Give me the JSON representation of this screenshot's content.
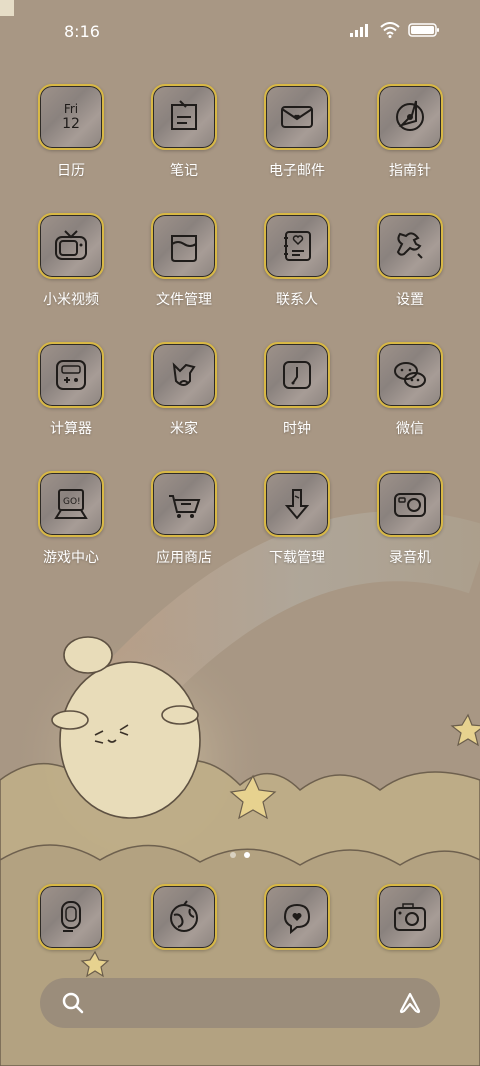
{
  "status": {
    "time": "8:16",
    "signal_icon": "signal-bars-icon",
    "wifi_icon": "wifi-icon",
    "battery_icon": "battery-icon"
  },
  "apps": [
    {
      "label": "日历",
      "icon": "calendar-icon",
      "day": "Fri",
      "date": "12"
    },
    {
      "label": "笔记",
      "icon": "notes-icon"
    },
    {
      "label": "电子邮件",
      "icon": "mail-icon"
    },
    {
      "label": "指南针",
      "icon": "compass-icon"
    },
    {
      "label": "小米视频",
      "icon": "tv-icon"
    },
    {
      "label": "文件管理",
      "icon": "folder-jar-icon"
    },
    {
      "label": "联系人",
      "icon": "contacts-book-icon"
    },
    {
      "label": "设置",
      "icon": "wrench-icon"
    },
    {
      "label": "计算器",
      "icon": "calculator-icon"
    },
    {
      "label": "米家",
      "icon": "mijia-icon"
    },
    {
      "label": "时钟",
      "icon": "clock-icon"
    },
    {
      "label": "微信",
      "icon": "wechat-icon"
    },
    {
      "label": "游戏中心",
      "icon": "game-console-icon"
    },
    {
      "label": "应用商店",
      "icon": "shopping-cart-icon"
    },
    {
      "label": "下载管理",
      "icon": "download-arrow-icon"
    },
    {
      "label": "录音机",
      "icon": "recorder-icon"
    }
  ],
  "dock": [
    {
      "icon": "phone-icon"
    },
    {
      "icon": "browser-globe-icon"
    },
    {
      "icon": "message-bubble-icon"
    },
    {
      "icon": "camera-icon"
    }
  ],
  "pager": {
    "pages": 2,
    "current": 2
  },
  "search": {
    "search_icon": "search-icon",
    "assistant_icon": "assistant-icon"
  },
  "colors": {
    "background": "#a89784",
    "icon_border": "#d8b845",
    "label": "#ffffff"
  }
}
